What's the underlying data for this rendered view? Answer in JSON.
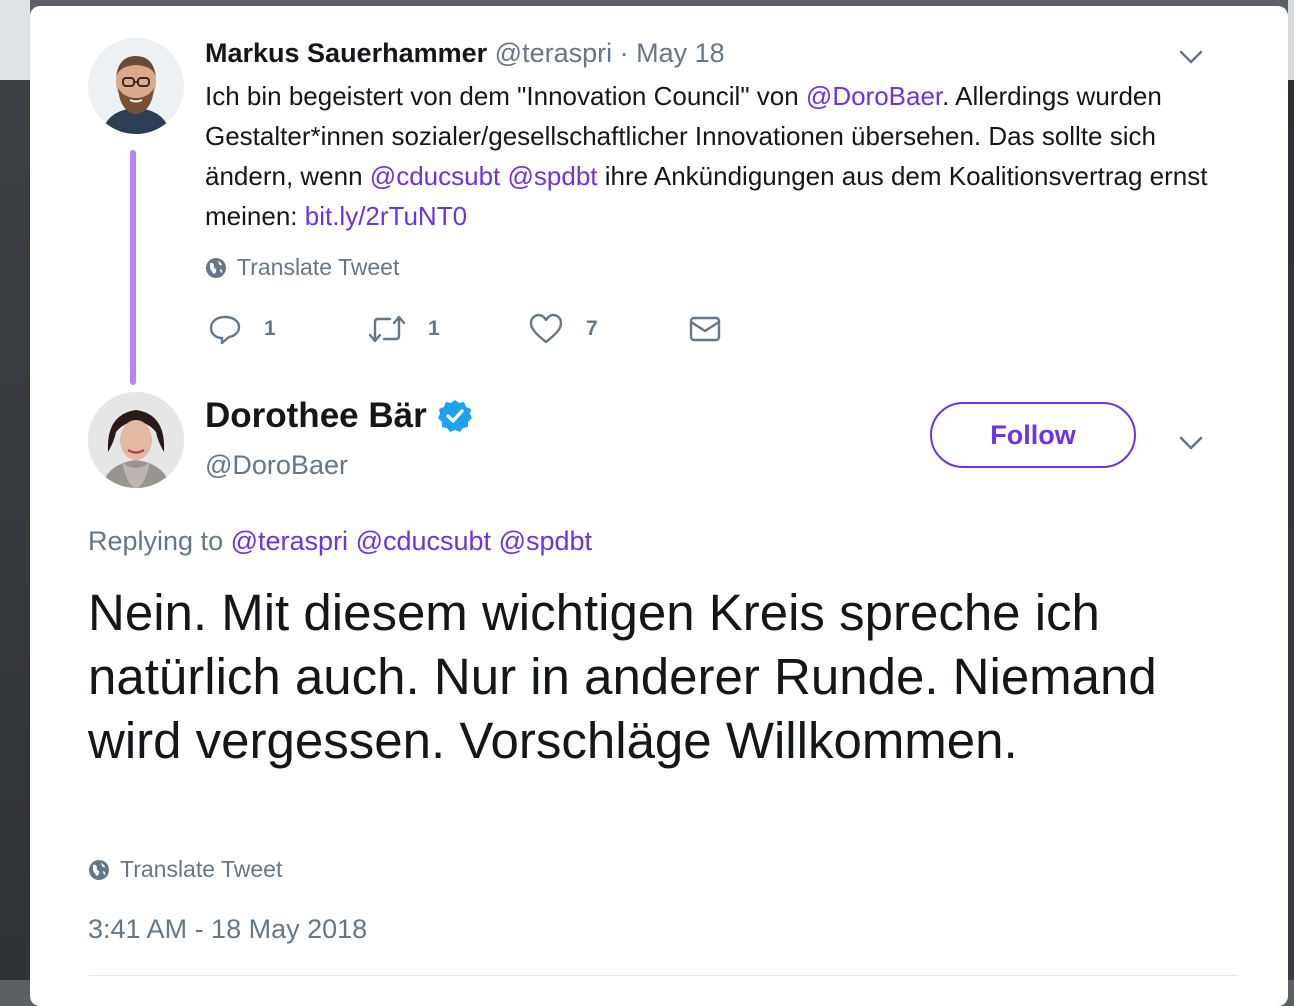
{
  "colors": {
    "accent": "#6e32e6",
    "thread_line": "#b386f8",
    "secondary_text": "#657786",
    "primary_text": "#14171a",
    "verified": "#1da1f2"
  },
  "quoted_tweet": {
    "author_name": "Markus Sauerhammer",
    "handle": "@teraspri",
    "separator": " · ",
    "date": "May 18",
    "avatar_icon": "avatar-bearded-man",
    "text_parts": [
      {
        "text": "Ich bin begeistert von dem \"Innovation Council\" von ",
        "link": false
      },
      {
        "text": "@DoroBaer",
        "link": true
      },
      {
        "text": ". Allerdings wurden Gestalter*innen sozialer/gesellschaftlicher Innovationen übersehen. Das sollte sich ändern, wenn ",
        "link": false
      },
      {
        "text": "@cducsubt",
        "link": true
      },
      {
        "text": " ",
        "link": false
      },
      {
        "text": "@spdbt",
        "link": true
      },
      {
        "text": " ihre Ankündigungen aus dem Koalitionsvertrag ernst meinen: ",
        "link": false
      },
      {
        "text": "bit.ly/2rTuNT0",
        "link": true
      }
    ],
    "translate_label": "Translate Tweet",
    "actions": {
      "reply_count": "1",
      "retweet_count": "1",
      "like_count": "7"
    }
  },
  "main_tweet": {
    "author_name": "Dorothee Bär",
    "handle": "@DoroBaer",
    "verified_icon": "verified-badge-icon",
    "follow_label": "Follow",
    "replying_prefix": "Replying to",
    "replying_to": [
      "@teraspri",
      "@cducsubt",
      "@spdbt"
    ],
    "text": "Nein. Mit diesem wichtigen Kreis spreche ich natürlich auch. Nur in anderer Runde. Niemand wird vergessen. Vorschläge Willkommen.",
    "translate_label": "Translate Tweet",
    "timestamp": "3:41 AM - 18 May 2018"
  }
}
